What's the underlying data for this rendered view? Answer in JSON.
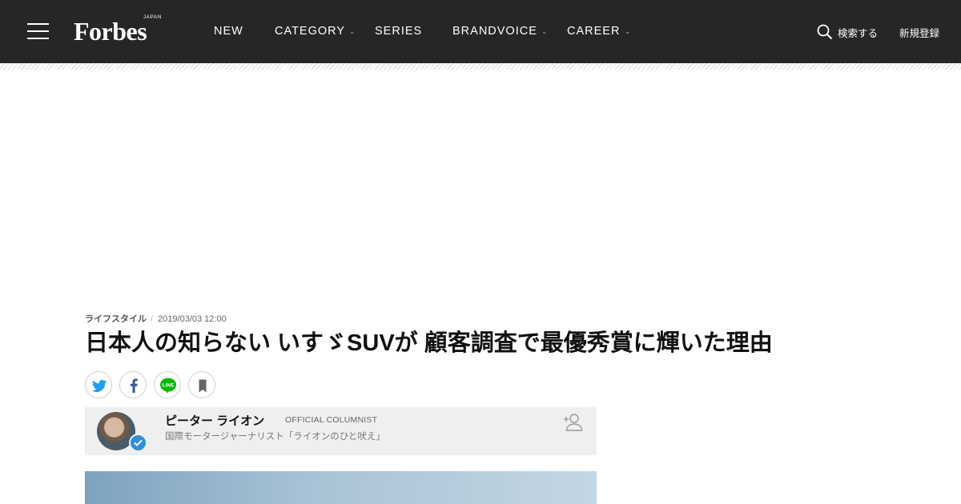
{
  "header": {
    "logo_text": "Forbes",
    "logo_sub": "JAPAN",
    "nav": [
      {
        "label": "NEW",
        "has_dropdown": false
      },
      {
        "label": "CATEGORY",
        "has_dropdown": true
      },
      {
        "label": "SERIES",
        "has_dropdown": false
      },
      {
        "label": "BRANDVOICE",
        "has_dropdown": true
      },
      {
        "label": "CAREER",
        "has_dropdown": true
      }
    ],
    "search_label": "検索する",
    "signup_label": "新規登録",
    "colors": {
      "bar": "#262626",
      "text": "#ffffff"
    }
  },
  "article": {
    "category": "ライフスタイル",
    "date": "2019/03/03 12:00",
    "title": "日本人の知らない いすゞSUVが 顧客調査で最優秀賞に輝いた理由",
    "share": [
      {
        "name": "twitter",
        "icon": "twitter-icon",
        "color": "#1da1f2"
      },
      {
        "name": "facebook",
        "icon": "facebook-icon",
        "color": "#3b5998"
      },
      {
        "name": "line",
        "icon": "line-icon",
        "color": "#00b900"
      },
      {
        "name": "bookmark",
        "icon": "bookmark-icon",
        "color": "#666666"
      }
    ],
    "author": {
      "name": "ピーター ライオン",
      "role": "OFFICIAL COLUMNIST",
      "description": "国際モータージャーナリスト「ライオンのひと吠え」"
    }
  }
}
